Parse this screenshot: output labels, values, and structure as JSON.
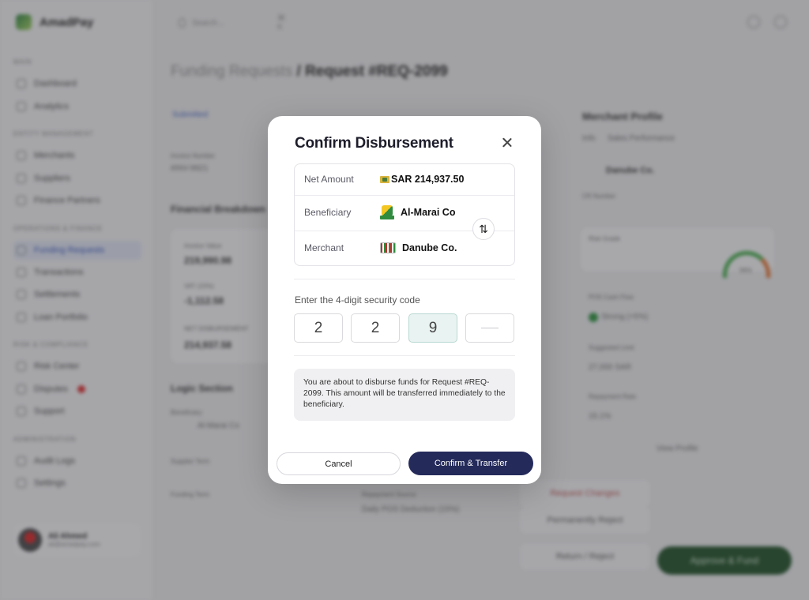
{
  "app": {
    "brand": "AmadPay",
    "search_placeholder": "Search...",
    "search_shortcut": "⌘ K",
    "sidebar": {
      "sections": [
        {
          "title": "Main",
          "items": [
            "Dashboard",
            "Analytics"
          ]
        },
        {
          "title": "Entity Management",
          "items": [
            "Merchants",
            "Suppliers",
            "Finance Partners"
          ]
        },
        {
          "title": "Operations & Finance",
          "items": [
            "Funding Requests",
            "Transactions",
            "Settlements",
            "Loan Portfolio"
          ]
        },
        {
          "title": "Risk & Compliance",
          "items": [
            "Risk Center",
            "Disputes",
            "Support"
          ]
        },
        {
          "title": "Administration",
          "items": [
            "Audit Logs",
            "Settings"
          ]
        }
      ],
      "active_item": "Funding Requests",
      "user": {
        "name": "Ali Ahmed",
        "email": "ali@amadpay.com"
      }
    },
    "page": {
      "breadcrumb_parent": "Funding Requests",
      "breadcrumb_sep": "/",
      "title": "Request #REQ-2099",
      "status": "Submitted",
      "invoice_label": "Invoice Number",
      "invoice_value": "#INV-9921",
      "financial_breakdown": "Financial Breakdown",
      "invoice_value_label": "Invoice Value",
      "invoice_value_amount": "219,990.98",
      "vat_label": "VAT (15%)",
      "vat_value": "-1,112.58",
      "net_label": "NET DISBURSEMENT",
      "net_value": "214,937.58",
      "logic_section": "Logic Section",
      "beneficiary_label": "Beneficiary",
      "beneficiary_value": "Al-Marai Co",
      "supplier_term_label": "Supplier Term",
      "funding_term_label": "Funding Term",
      "repayment_label": "Repayment Source",
      "repayment_value": "Daily POS Deduction (15%)"
    },
    "right_panel": {
      "title": "Merchant Profile",
      "tabs": [
        "Info",
        "Sales Performance"
      ],
      "merchant": "Danube Co.",
      "cr_label": "CR Number",
      "risk_label": "Risk Grade",
      "pos_label": "POS Cash Flow",
      "pos_value": "Strong (+5%)",
      "limit_label": "Suggested Limit",
      "limit_value": "27,000 SAR",
      "repayment_rate_label": "Repayment Rate",
      "repayment_rate_value": "15.1%",
      "view_profile": "View Profile",
      "gauge_value": "96%"
    },
    "actions": {
      "request_changes": "Request Changes",
      "reject": "Permanently Reject",
      "return": "Return / Reject",
      "approve": "Approve & Fund"
    }
  },
  "modal": {
    "title": "Confirm Disbursement",
    "rows": [
      {
        "label": "Net Amount",
        "value": "SAR 214,937.50",
        "icon": "sar-currency-icon"
      },
      {
        "label": "Beneficiary",
        "value": "Al-Marai Co",
        "icon": "almarai-logo-icon"
      },
      {
        "label": "Merchant",
        "value": "Danube Co.",
        "icon": "danube-logo-icon"
      }
    ],
    "code_label": "Enter the 4-digit security code",
    "code_digits": [
      "2",
      "2",
      "9",
      ""
    ],
    "notice": "You are about to disburse funds for Request #REQ-2099. This amount will be transferred immediately to the beneficiary.",
    "cancel_label": "Cancel",
    "confirm_label": "Confirm & Transfer",
    "swap_glyph": "⇅",
    "colors": {
      "primary": "#242a5a",
      "focus": "#e9f3f1"
    }
  }
}
